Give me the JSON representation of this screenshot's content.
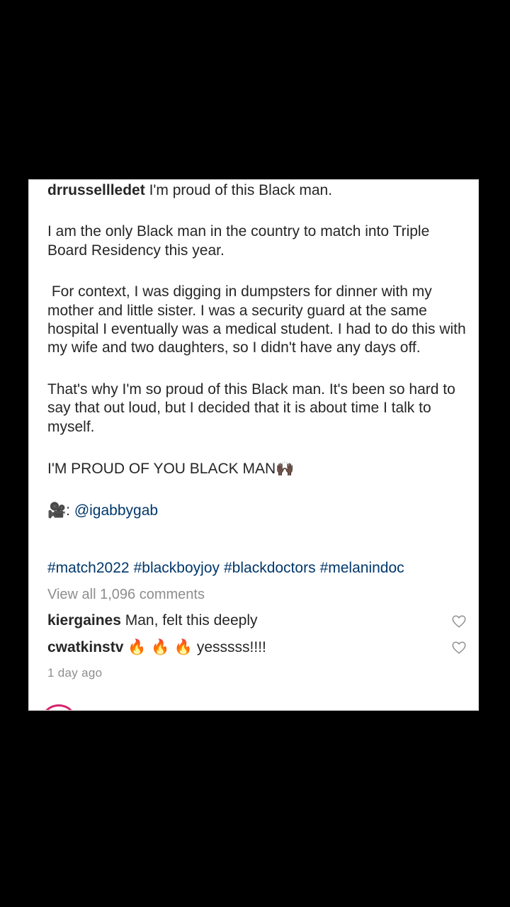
{
  "post": {
    "username": "drrussellledet",
    "paragraph1": "I'm proud of this Black man.",
    "paragraph2": "I am the only Black man in the country to match into Triple Board Residency this year.",
    "paragraph3": " For context, I was digging in dumpsters for dinner with my mother and little sister. I was a security guard at the same hospital I eventually was a medical student. I had to do this with my wife and two daughters, so I didn't have any days off.",
    "paragraph4": "That's why I'm so proud of this Black man. It's been so hard to say that out loud, but I decided that it is about time I talk to myself.",
    "paragraph5": "I'M PROUD OF YOU BLACK MAN",
    "paragraph5_emoji": "🙌🏿",
    "credit_emoji": "🎥",
    "credit_sep": ": ",
    "credit_handle": "@igabbygab",
    "hashtags": [
      "#match2022",
      "#blackboyjoy",
      "#blackdoctors",
      "#melanindoc"
    ]
  },
  "comments_link": "View all 1,096 comments",
  "comments": [
    {
      "username": "kiergaines",
      "text": "Man, felt this deeply",
      "icon": "heart-outline-icon"
    },
    {
      "username": "cwatkinstv",
      "emoji": "🔥 🔥 🔥",
      "text": "yesssss!!!!",
      "icon": "heart-outline-icon"
    }
  ],
  "timestamp": "1 day ago",
  "colors": {
    "background": "#000000",
    "card": "#ffffff",
    "text": "#262626",
    "link": "#00376b",
    "muted": "#8e8e8e",
    "avatar_ring": "#d6246e"
  }
}
